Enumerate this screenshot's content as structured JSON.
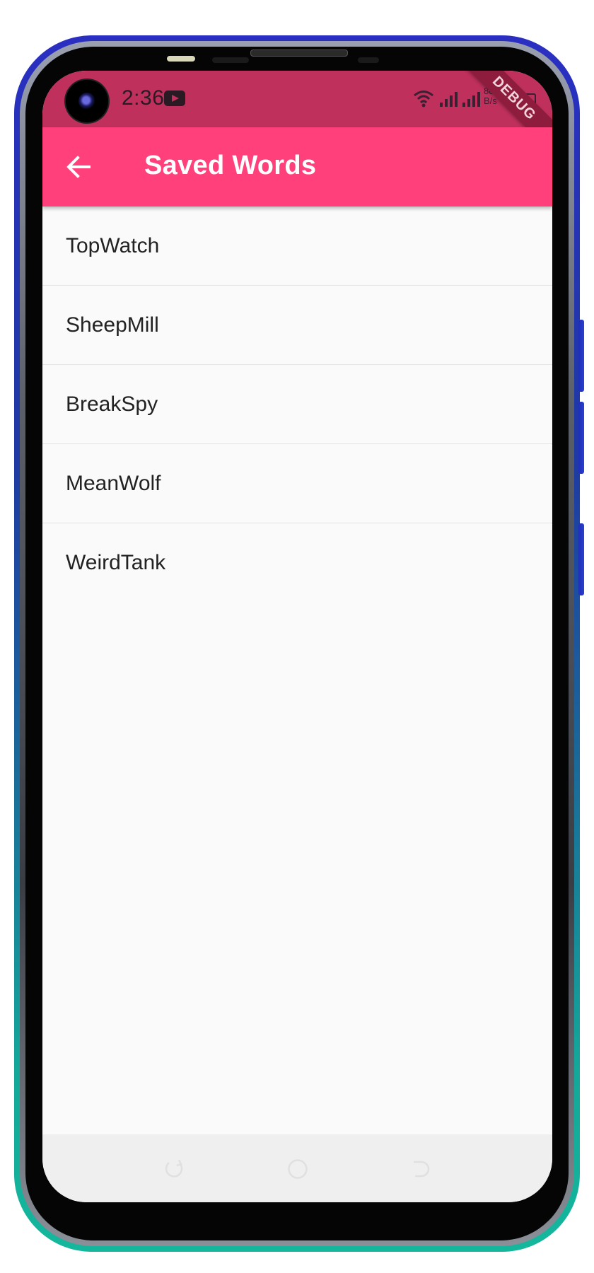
{
  "status_bar": {
    "time": "2:36",
    "net_speed_value": "88",
    "net_speed_unit": "B/s",
    "background_color": "#c0305d"
  },
  "debug_banner": {
    "label": "DEBUG"
  },
  "app_bar": {
    "title": "Saved Words",
    "background_color": "#ff407b",
    "back_icon": "arrow-left-icon"
  },
  "saved_words": [
    {
      "label": "TopWatch"
    },
    {
      "label": "SheepMill"
    },
    {
      "label": "BreakSpy"
    },
    {
      "label": "MeanWolf"
    },
    {
      "label": "WeirdTank"
    }
  ],
  "nav_bar": {
    "icons": [
      "nav-back-icon",
      "nav-home-icon",
      "nav-recent-icon"
    ]
  }
}
